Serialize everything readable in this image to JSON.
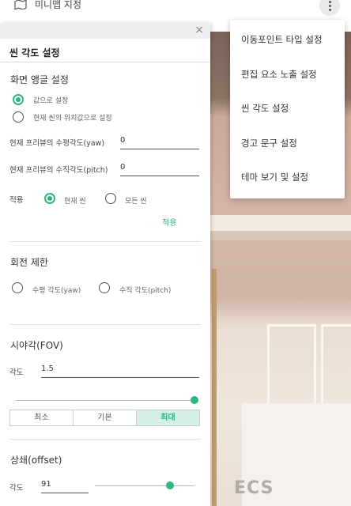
{
  "topbar": {
    "minimap_label": "미니맵 지정"
  },
  "menu": {
    "items": [
      "이동포인트 타입 설정",
      "편집 요소 노출 설정",
      "씬 각도 설정",
      "경고 문구 설정",
      "테마 보기 및 설정"
    ]
  },
  "panel": {
    "close_label": "×",
    "title": "씬 각도 설정",
    "screen_angle": {
      "title": "화면 앵글 설정",
      "opt_value": "값으로 설정",
      "opt_current": "현재 씬의 위치값으로 설정",
      "yaw_label": "현재 프리뷰의 수평각도(yaw)",
      "yaw_value": "0",
      "pitch_label": "현재 프리뷰의 수직각도(pitch)",
      "pitch_value": "0",
      "apply_label": "적용",
      "apply_current": "현재 씬",
      "apply_all": "모든 씬",
      "apply_link": "적용"
    },
    "rotation": {
      "title": "회전 제한",
      "yaw": "수평 각도(yaw)",
      "pitch": "수직 각도(pitch)"
    },
    "fov": {
      "title": "시야각(FOV)",
      "angle_label": "각도",
      "angle_value": "1.5",
      "slider_level": 1.0,
      "seg": [
        "최소",
        "기본",
        "최대"
      ]
    },
    "offset": {
      "title": "상쇄(offset)",
      "angle_label": "각도",
      "angle_value": "91",
      "slider_level": 0.75
    }
  },
  "scene": {
    "brand_text": "ECS"
  },
  "colors": {
    "accent": "#2eb67d"
  }
}
